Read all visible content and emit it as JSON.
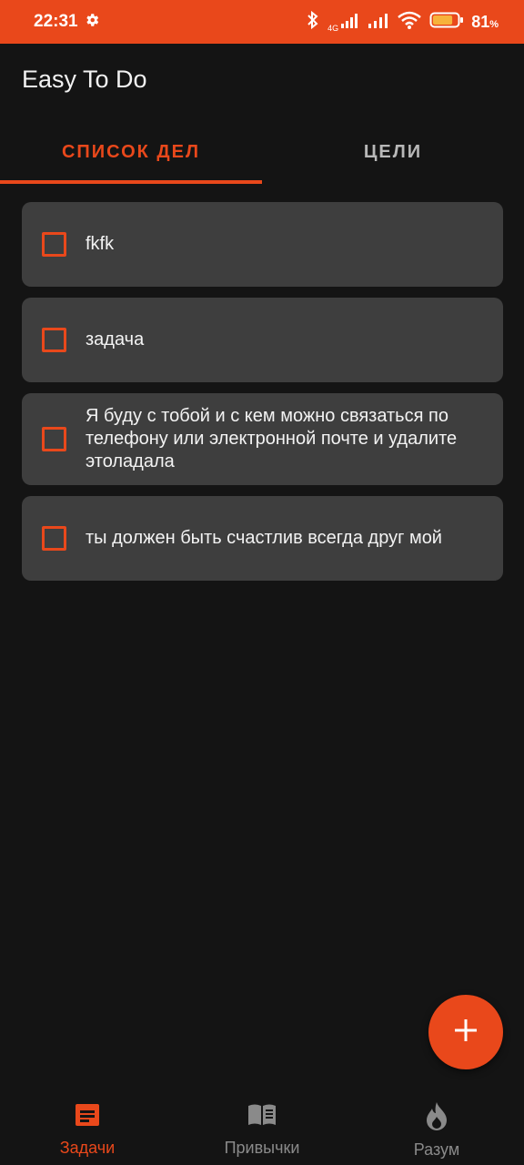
{
  "status_bar": {
    "time": "22:31",
    "network_label": "4G",
    "battery_percent": "81",
    "battery_unit": "%",
    "battery_level": 0.81,
    "background_color": "#e9481b",
    "icons": [
      "gear-icon",
      "bluetooth-icon",
      "signal-icon",
      "signal-icon",
      "wifi-icon",
      "battery-icon"
    ]
  },
  "app_bar": {
    "title": "Easy To Do"
  },
  "tabs": [
    {
      "label": "СПИСОК ДЕЛ",
      "active": true
    },
    {
      "label": "ЦЕЛИ",
      "active": false
    }
  ],
  "tasks": [
    {
      "text": "fkfk",
      "checked": false
    },
    {
      "text": "задача",
      "checked": false
    },
    {
      "text": "Я буду с тобой и с кем можно связаться по телефону или электронной почте и удалите этоладала",
      "checked": false
    },
    {
      "text": "ты должен быть счастлив всегда друг мой",
      "checked": false
    }
  ],
  "fab": {
    "icon": "plus-icon"
  },
  "bottom_nav": [
    {
      "label": "Задачи",
      "icon": "notes-icon",
      "active": true
    },
    {
      "label": "Привычки",
      "icon": "book-icon",
      "active": false
    },
    {
      "label": "Разум",
      "icon": "flame-icon",
      "active": false
    }
  ],
  "colors": {
    "accent": "#e9481b",
    "background": "#141414",
    "card": "#3e3e3e",
    "inactive": "#8a8a8a"
  }
}
